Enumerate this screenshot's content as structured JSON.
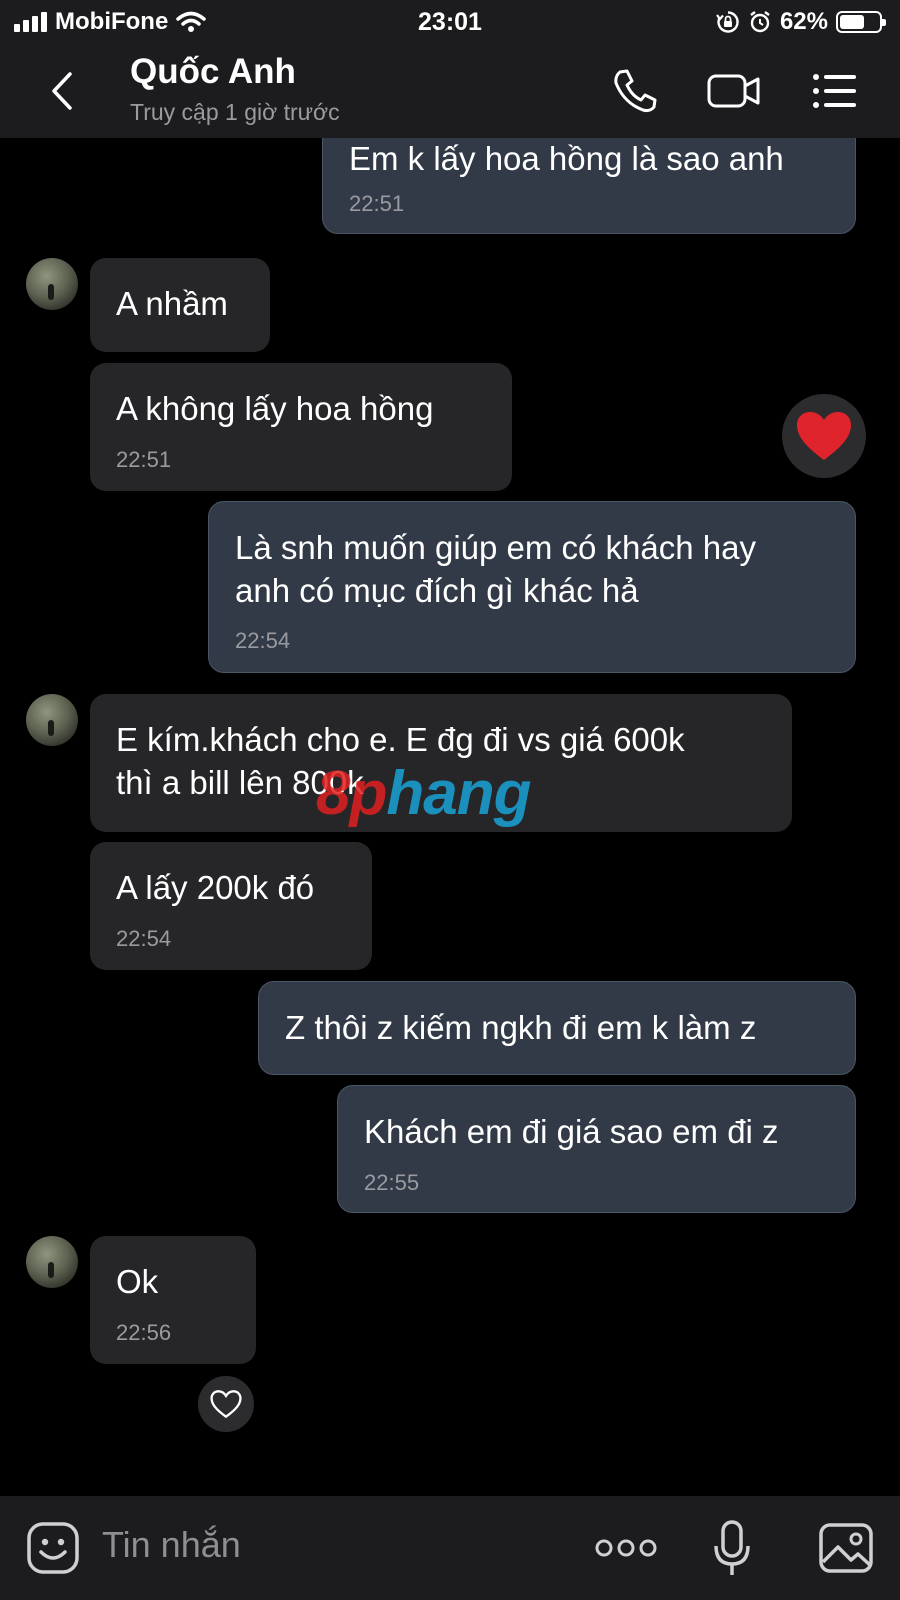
{
  "status_bar": {
    "carrier": "MobiFone",
    "time": "23:01",
    "battery_percent": "62%",
    "battery_level": 0.62,
    "icons": [
      "signal-bars-icon",
      "wifi-icon",
      "orientation-lock-icon",
      "alarm-icon",
      "battery-icon"
    ]
  },
  "header": {
    "contact_name": "Quốc Anh",
    "contact_status": "Truy cập 1 giờ trước",
    "icons": [
      "back-chevron-icon",
      "phone-icon",
      "video-camera-icon",
      "menu-icon"
    ]
  },
  "messages": [
    {
      "direction": "out",
      "text": "Em k lấy hoa hồng là sao anh",
      "time": "22:51"
    },
    {
      "direction": "in",
      "text": "A nhầm",
      "time": ""
    },
    {
      "direction": "in",
      "text": "A không lấy hoa hồng",
      "time": "22:51",
      "reaction": "❤"
    },
    {
      "direction": "out",
      "text": "Là snh muốn giúp em có khách hay\nanh có mục đích gì khác hả",
      "time": "22:54"
    },
    {
      "direction": "in",
      "text": "E kím.khách cho e. E đg đi vs giá 600k\nthì a bill lên 800k",
      "time": ""
    },
    {
      "direction": "in",
      "text": "A lấy 200k đó",
      "time": "22:54"
    },
    {
      "direction": "out",
      "text": "Z thôi z kiếm ngkh đi em k làm z",
      "time": ""
    },
    {
      "direction": "out",
      "text": "Khách em đi giá sao em đi z",
      "time": "22:55"
    },
    {
      "direction": "in",
      "text": "Ok",
      "time": "22:56"
    }
  ],
  "watermark": {
    "part1": "8p",
    "part2": "hang"
  },
  "composer": {
    "placeholder": "Tin nhắn",
    "icons": [
      "emoji-icon",
      "more-dots-icon",
      "microphone-icon",
      "image-icon"
    ]
  },
  "colors": {
    "background": "#000000",
    "bar_background": "#1c1c1e",
    "incoming_bubble": "#262628",
    "outgoing_bubble": "#323a47",
    "secondary_text": "#9a9aa0",
    "heart": "#e0242b"
  }
}
